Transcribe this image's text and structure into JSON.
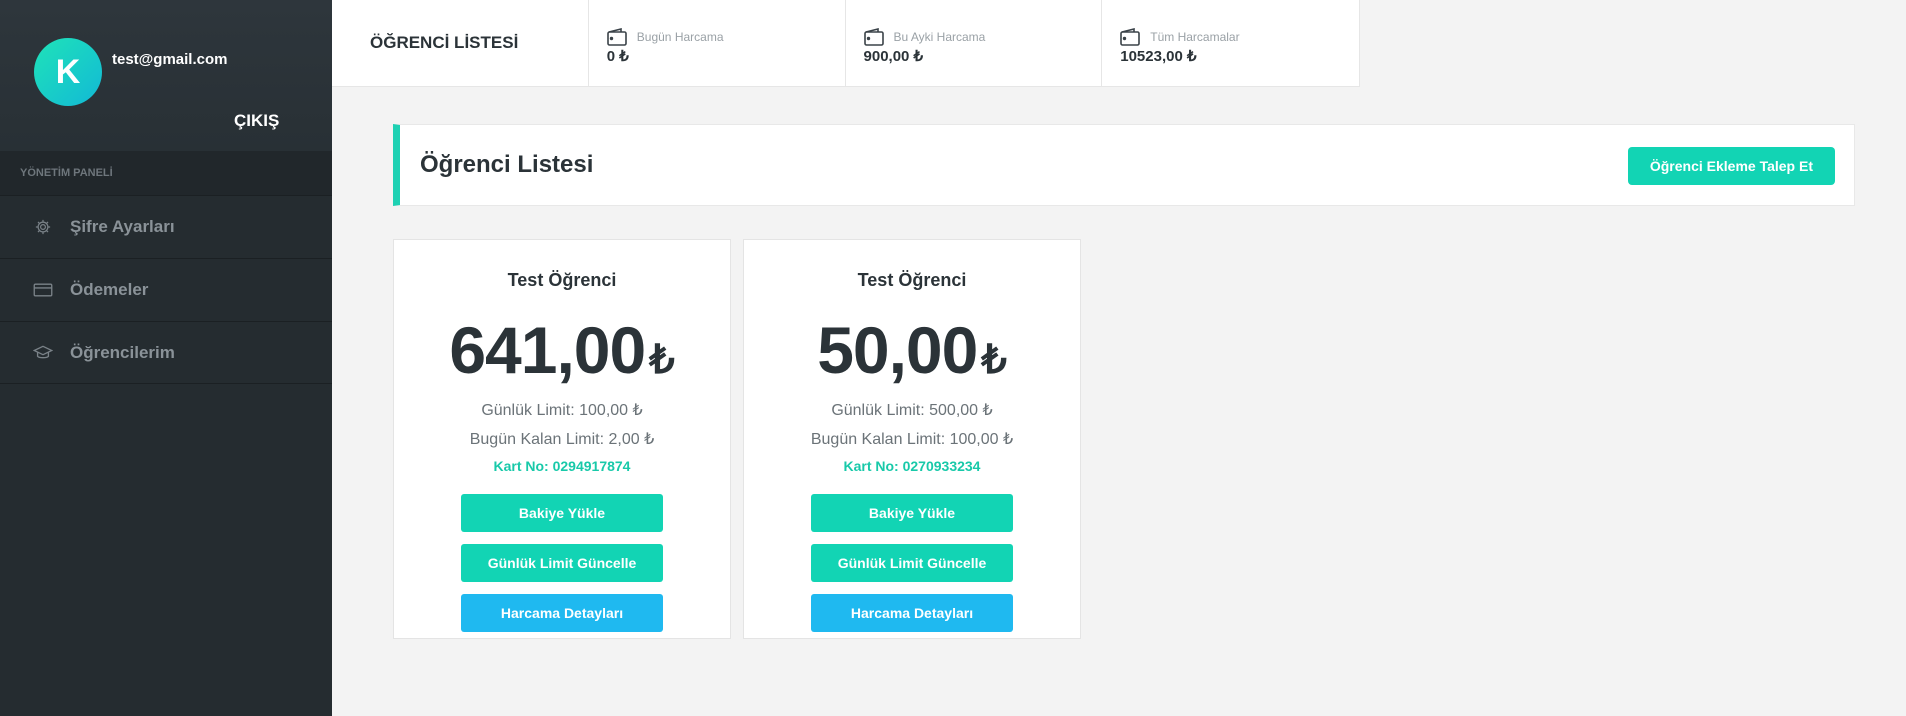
{
  "sidebar": {
    "avatar_letter": "K",
    "email": "test@gmail.com",
    "logout_label": "ÇIKIŞ",
    "panel_title": "YÖNETİM PANELİ",
    "items": [
      {
        "label": "Şifre Ayarları",
        "icon": "gear-icon"
      },
      {
        "label": "Ödemeler",
        "icon": "credit-card-icon"
      },
      {
        "label": "Öğrencilerim",
        "icon": "graduation-cap-icon"
      }
    ]
  },
  "topbar": {
    "title": "ÖĞRENCİ LİSTESİ",
    "stats": [
      {
        "label": "Bugün Harcama",
        "value": "0 ₺"
      },
      {
        "label": "Bu Ayki Harcama",
        "value": "900,00 ₺"
      },
      {
        "label": "Tüm Harcamalar",
        "value": "10523,00 ₺"
      }
    ]
  },
  "main": {
    "heading": "Öğrenci Listesi",
    "add_button": "Öğrenci Ekleme Talep Et",
    "students": [
      {
        "name": "Test Öğrenci",
        "balance": "641,00",
        "currency": "₺",
        "daily_limit": "Günlük Limit: 100,00 ₺",
        "remaining_limit": "Bugün Kalan Limit: 2,00 ₺",
        "card_no": "Kart No: 0294917874",
        "load_button": "Bakiye Yükle",
        "update_limit_button": "Günlük Limit Güncelle",
        "details_button": "Harcama Detayları"
      },
      {
        "name": "Test Öğrenci",
        "balance": "50,00",
        "currency": "₺",
        "daily_limit": "Günlük Limit: 500,00 ₺",
        "remaining_limit": "Bugün Kalan Limit: 100,00 ₺",
        "card_no": "Kart No: 0270933234",
        "load_button": "Bakiye Yükle",
        "update_limit_button": "Günlük Limit Güncelle",
        "details_button": "Harcama Detayları"
      }
    ]
  },
  "colors": {
    "accent": "#12d4b4",
    "info": "#1fb9f0",
    "sidebar": "#252c30"
  }
}
